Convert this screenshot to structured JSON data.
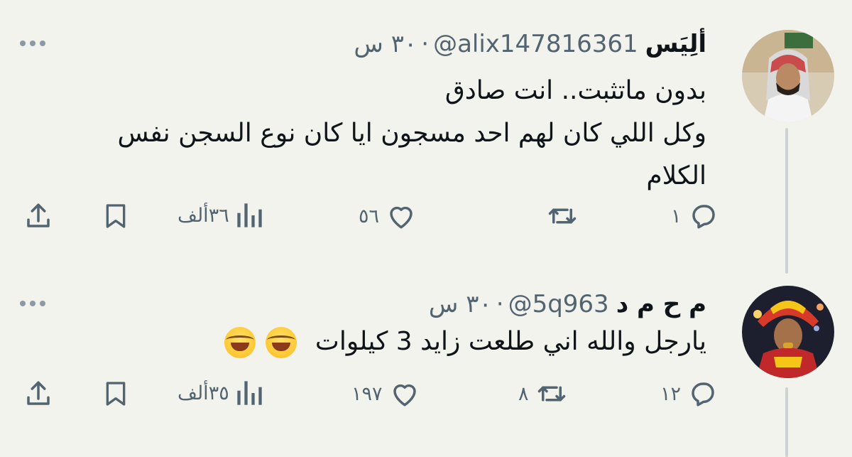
{
  "tweets": [
    {
      "name": "ألِيَس",
      "handle": "@alix147816361",
      "dot": "·",
      "time": "٣٠ س",
      "lines": [
        "بدون ماتثبت..  انت صادق",
        "وكل اللي كان لهم احد مسجون ايا كان نوع السجن نفس",
        "الكلام"
      ],
      "replies": "١",
      "retweets": "",
      "likes": "٥٦",
      "views": "٣٦أ‏لف"
    },
    {
      "name": "م ح م د",
      "handle": "@5q963",
      "dot": "·",
      "time": "٣٠ س",
      "text": "يارجل والله اني طلعت زايد 3 كيلوات",
      "emoji": [
        "face-with-tears-of-joy",
        "face-with-tears-of-joy"
      ],
      "replies": "١٢",
      "retweets": "٨",
      "likes": "١٩٧",
      "views": "٣٥أ‏لف"
    }
  ],
  "colors": {
    "background": "#f3f3ee",
    "text": "#0f1419",
    "secondary": "#536471",
    "thread": "#cfd2d4"
  }
}
